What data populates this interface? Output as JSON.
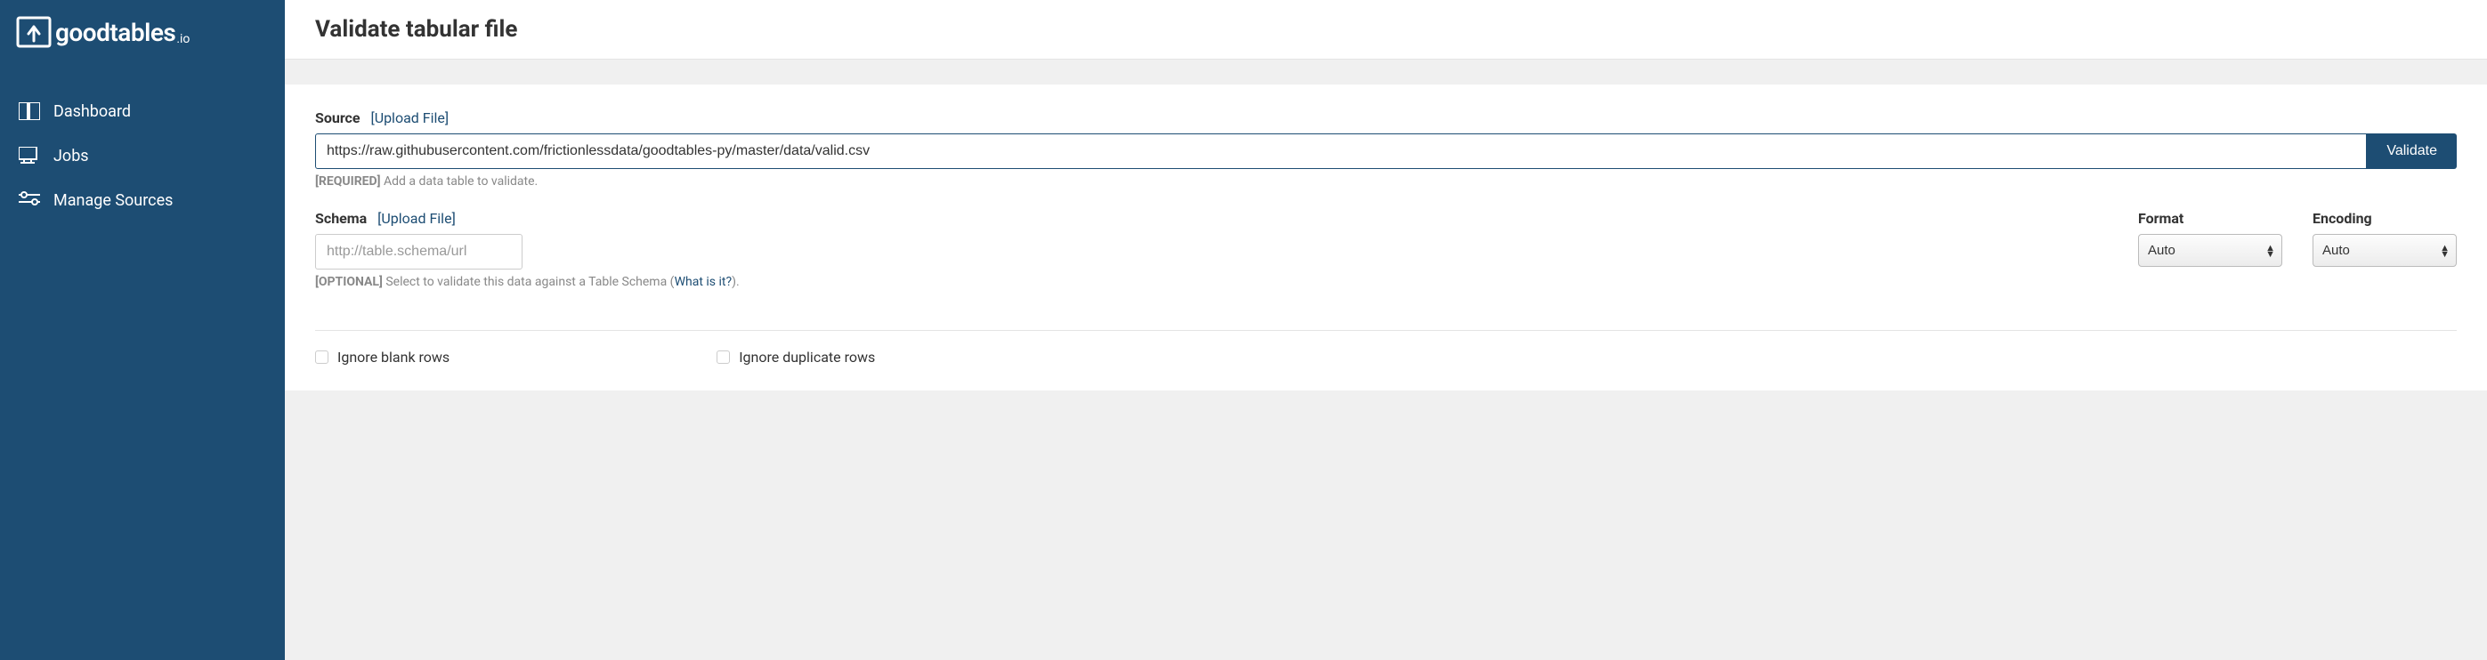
{
  "brand": {
    "name": "goodtables",
    "suffix": ".io"
  },
  "sidebar": {
    "items": [
      {
        "label": "Dashboard"
      },
      {
        "label": "Jobs"
      },
      {
        "label": "Manage Sources"
      }
    ]
  },
  "header": {
    "title": "Validate tabular file"
  },
  "form": {
    "source": {
      "label": "Source",
      "upload_link": "Upload File",
      "value": "https://raw.githubusercontent.com/frictionlessdata/goodtables-py/master/data/valid.csv",
      "validate_label": "Validate",
      "help_tag": "[REQUIRED]",
      "help_text": "Add a data table to validate."
    },
    "schema": {
      "label": "Schema",
      "upload_link": "Upload File",
      "placeholder": "http://table.schema/url",
      "help_tag": "[OPTIONAL]",
      "help_text": "Select to validate this data against a Table Schema (",
      "help_link": "What is it?",
      "help_close": ")."
    },
    "format": {
      "label": "Format",
      "selected": "Auto"
    },
    "encoding": {
      "label": "Encoding",
      "selected": "Auto"
    },
    "checkboxes": {
      "ignore_blank": "Ignore blank rows",
      "ignore_duplicate": "Ignore duplicate rows"
    }
  }
}
